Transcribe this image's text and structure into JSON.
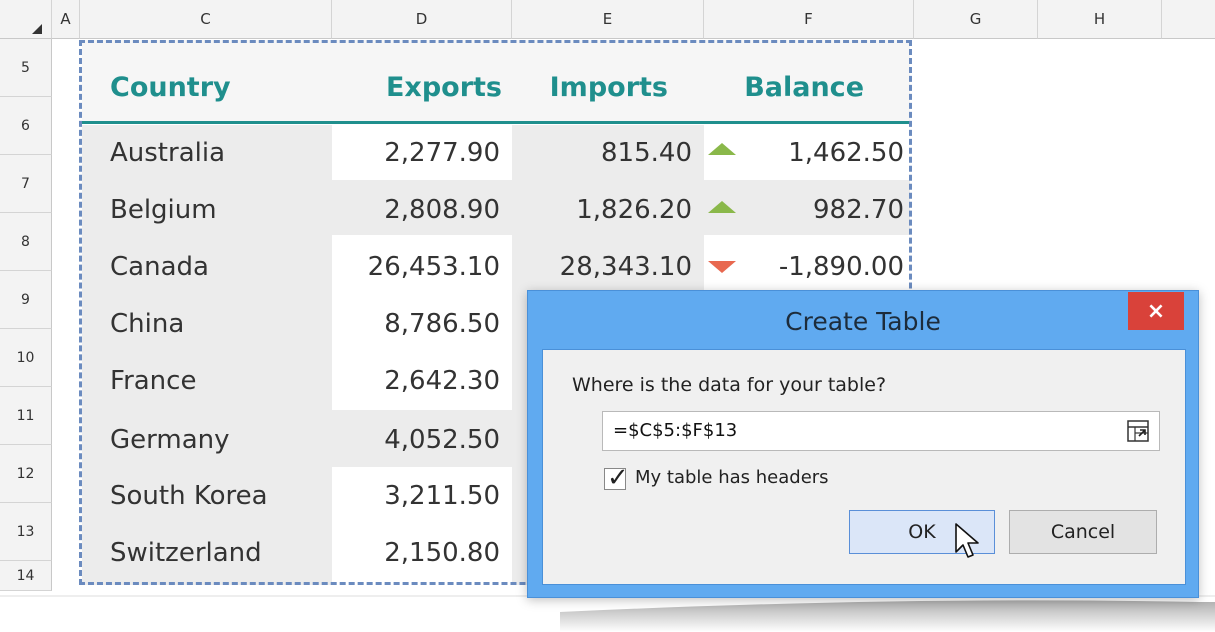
{
  "columns": [
    "A",
    "C",
    "D",
    "E",
    "F",
    "G",
    "H"
  ],
  "rows": [
    "5",
    "6",
    "7",
    "8",
    "9",
    "10",
    "11",
    "12",
    "13",
    "14"
  ],
  "table": {
    "headers": {
      "country": "Country",
      "exports": "Exports",
      "imports": "Imports",
      "balance": "Balance"
    },
    "rows": [
      {
        "country": "Australia",
        "exports": "2,277.90",
        "imports": "815.40",
        "trend": "up",
        "balance": "1,462.50"
      },
      {
        "country": "Belgium",
        "exports": "2,808.90",
        "imports": "1,826.20",
        "trend": "up",
        "balance": "982.70"
      },
      {
        "country": "Canada",
        "exports": "26,453.10",
        "imports": "28,343.10",
        "trend": "down",
        "balance": "-1,890.00"
      },
      {
        "country": "China",
        "exports": "8,786.50"
      },
      {
        "country": "France",
        "exports": "2,642.30"
      },
      {
        "country": "Germany",
        "exports": "4,052.50"
      },
      {
        "country": "South Korea",
        "exports": "3,211.50"
      },
      {
        "country": "Switzerland",
        "exports": "2,150.80"
      }
    ]
  },
  "colors": {
    "header_text": "#1f8f8d",
    "trend_up": "#8ab84a",
    "trend_down": "#e8684f",
    "dialog_frame": "#60aaf0",
    "close_button": "#d9423a"
  },
  "dialog": {
    "title": "Create Table",
    "close_glyph": "×",
    "prompt": "Where is the data for your table?",
    "range_value": "=$C$5:$F$13",
    "range_icon": "collapse-dialog-icon",
    "headers_checked": true,
    "headers_label": "My table has headers",
    "check_glyph": "✓",
    "ok_label": "OK",
    "cancel_label": "Cancel"
  }
}
